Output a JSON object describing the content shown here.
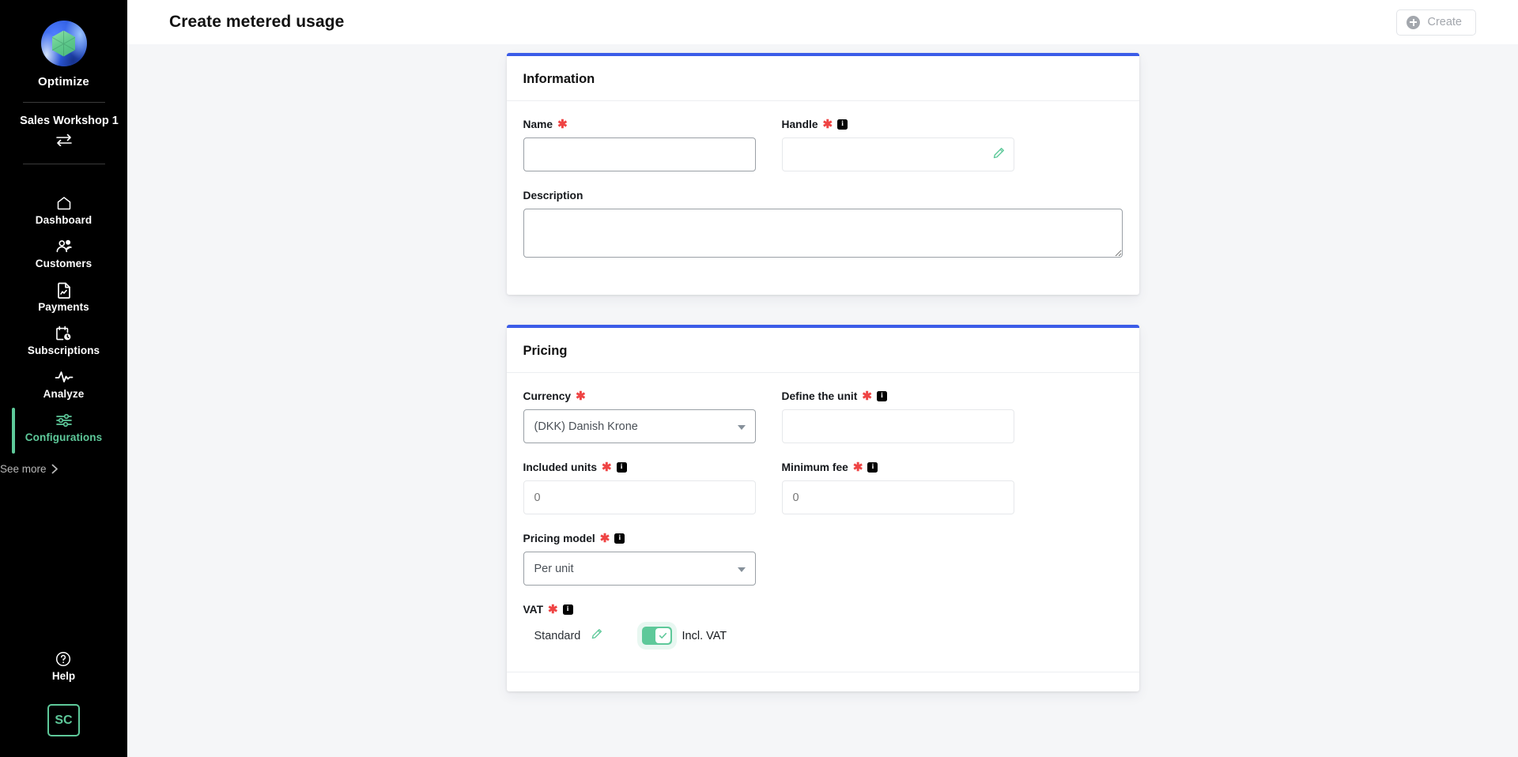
{
  "sidebar": {
    "brand": {
      "name": "Optimize",
      "logo_icon": "optimize-sphere-logo"
    },
    "workspace": {
      "name": "Sales Workshop 1",
      "switch_icon": "switch-arrows-icon"
    },
    "nav_items": [
      {
        "label": "Dashboard",
        "icon": "home-icon",
        "active": false
      },
      {
        "label": "Customers",
        "icon": "users-icon",
        "active": false
      },
      {
        "label": "Payments",
        "icon": "document-chart-icon",
        "active": false
      },
      {
        "label": "Subscriptions",
        "icon": "calendar-clock-icon",
        "active": false
      },
      {
        "label": "Analyze",
        "icon": "pulse-icon",
        "active": false
      },
      {
        "label": "Configurations",
        "icon": "sliders-icon",
        "active": true
      }
    ],
    "see_more": {
      "label": "See more",
      "icon": "chevron-right-icon"
    },
    "help": {
      "label": "Help",
      "icon": "question-circle-icon"
    },
    "avatar": {
      "initials": "SC"
    },
    "accent_color": "#5ec99a"
  },
  "topbar": {
    "title": "Create metered usage",
    "create_button": {
      "label": "Create",
      "icon": "plus-circle-icon",
      "disabled": true
    }
  },
  "cards": {
    "information": {
      "title": "Information",
      "accent_color": "#3b5ce8",
      "name": {
        "label": "Name",
        "required": true,
        "value": "",
        "placeholder": ""
      },
      "handle": {
        "label": "Handle",
        "required": true,
        "value": "",
        "placeholder": "",
        "info_icon": "info-icon",
        "edit_icon": "pencil-icon"
      },
      "description": {
        "label": "Description",
        "required": false,
        "value": "",
        "placeholder": ""
      }
    },
    "pricing": {
      "title": "Pricing",
      "accent_color": "#3b5ce8",
      "currency": {
        "label": "Currency",
        "required": true,
        "value": "(DKK) Danish Krone",
        "options": [
          "(DKK) Danish Krone"
        ]
      },
      "define_the_unit": {
        "label": "Define the unit",
        "required": true,
        "value": "",
        "placeholder": "",
        "info_icon": "info-icon"
      },
      "included_units": {
        "label": "Included units",
        "required": true,
        "value": "",
        "placeholder": "0",
        "info_icon": "info-icon"
      },
      "minimum_fee": {
        "label": "Minimum fee",
        "required": true,
        "value": "",
        "placeholder": "0",
        "info_icon": "info-icon"
      },
      "pricing_model": {
        "label": "Pricing model",
        "required": true,
        "value": "Per unit",
        "options": [
          "Per unit"
        ],
        "info_icon": "info-icon"
      },
      "vat": {
        "label": "VAT",
        "required": true,
        "info_icon": "info-icon",
        "rate_label": "Standard",
        "edit_icon": "pencil-icon",
        "incl_vat_label": "Incl. VAT",
        "incl_vat_on": true
      }
    }
  }
}
